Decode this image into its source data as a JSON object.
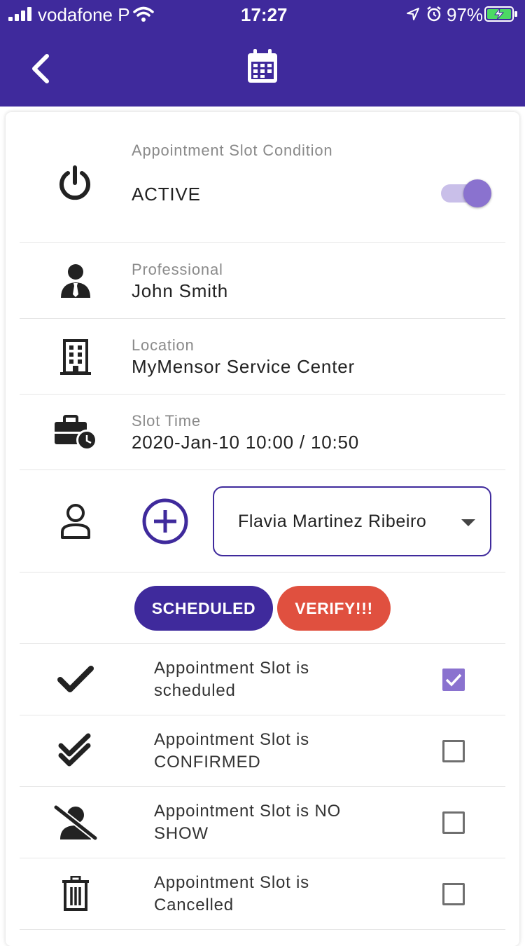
{
  "status_bar": {
    "carrier": "vodafone P",
    "time": "17:27",
    "battery": "97%"
  },
  "app_bar": {
    "back_icon": "chevron-left-icon",
    "title_icon": "calendar-icon"
  },
  "condition": {
    "label": "Appointment Slot Condition",
    "value": "ACTIVE",
    "enabled": true
  },
  "professional": {
    "label": "Professional",
    "value": "John Smith"
  },
  "location": {
    "label": "Location",
    "value": "MyMensor Service Center"
  },
  "slot_time": {
    "label": "Slot Time",
    "value": "2020-Jan-10 10:00 / 10:50"
  },
  "client": {
    "selected": "Flavia Martinez Ribeiro"
  },
  "buttons": {
    "scheduled": "SCHEDULED",
    "verify": "VERIFY!!!"
  },
  "statuses": [
    {
      "text": "Appointment Slot is scheduled",
      "checked": true,
      "icon": "check-icon"
    },
    {
      "text": "Appointment Slot is CONFIRMED",
      "checked": false,
      "icon": "double-check-icon"
    },
    {
      "text": "Appointment Slot is NO SHOW",
      "checked": false,
      "icon": "person-off-icon"
    },
    {
      "text": "Appointment Slot is Cancelled",
      "checked": false,
      "icon": "trash-icon"
    }
  ],
  "colors": {
    "primary": "#3f2a9c",
    "accent": "#8a72cf",
    "danger": "#e0503f"
  }
}
